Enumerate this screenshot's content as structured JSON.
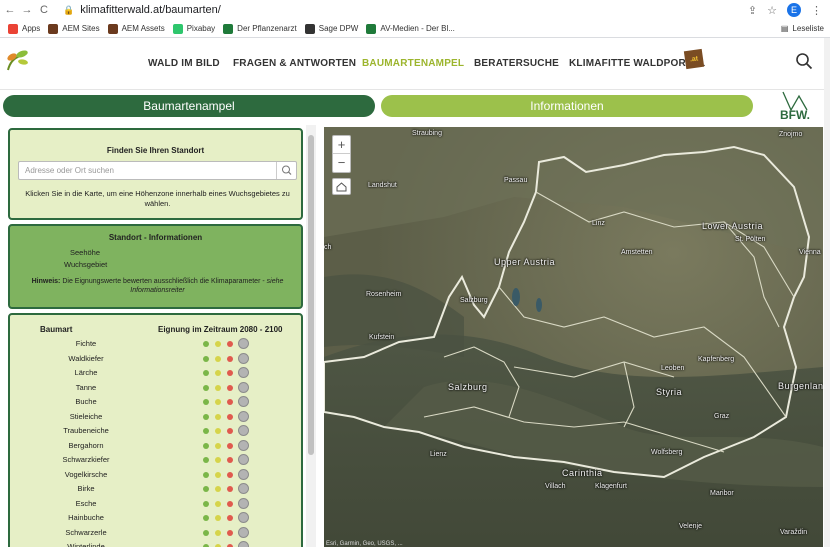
{
  "browser": {
    "url": "klimafitterwald.at/baumarten/",
    "profile_initial": "E",
    "bookmarks": [
      {
        "label": "Apps",
        "color": "#ea4335"
      },
      {
        "label": "AEM Sites",
        "color": "#6b3a1e"
      },
      {
        "label": "AEM Assets",
        "color": "#6b3a1e"
      },
      {
        "label": "Pixabay",
        "color": "#2ec66d"
      },
      {
        "label": "Der Pflanzenarzt",
        "color": "#1f7a3a"
      },
      {
        "label": "Sage DPW",
        "color": "#333333"
      },
      {
        "label": "AV-Medien - Der Bl...",
        "color": "#1f7a3a"
      }
    ],
    "reading_list": "Leseliste"
  },
  "site": {
    "nav": [
      {
        "label": "WALD IM BILD",
        "active": false
      },
      {
        "label": "FRAGEN & ANTWORTEN",
        "active": false
      },
      {
        "label": "BAUMARTENAMPEL",
        "active": true
      },
      {
        "label": "BERATERSUCHE",
        "active": false
      },
      {
        "label": "KLIMAFITTE WALDPORTAL",
        "active": false
      }
    ],
    "badge": ".at",
    "bfw_logo_text": "BFW."
  },
  "tabs": {
    "left": "Baumartenampel",
    "right": "Informationen"
  },
  "location_box": {
    "title": "Finden Sie Ihren Standort",
    "search_placeholder": "Adresse oder Ort suchen",
    "help_text": "Klicken Sie in die Karte, um eine Höhenzone innerhalb eines Wuchsgebietes zu wählen."
  },
  "info_box": {
    "title": "Standort - Informationen",
    "altitude_label": "Seehöhe",
    "region_label": "Wuchsgebiet",
    "hint_label": "Hinweis:",
    "hint_text": "Die Eignungswerte bewerten ausschließlich die Klimaparameter -",
    "hint_link": "siehe Informationsreiter"
  },
  "species_table": {
    "col_species": "Baumart",
    "col_suitability": "Eignung im Zeitraum 2080 - 2100",
    "species": [
      "Fichte",
      "Waldkiefer",
      "Lärche",
      "Tanne",
      "Buche",
      "Stieleiche",
      "Traubeneiche",
      "Bergahorn",
      "Schwarzkiefer",
      "Vogelkirsche",
      "Birke",
      "Esche",
      "Hainbuche",
      "Schwarzerle",
      "Winterlinde"
    ]
  },
  "map": {
    "zoom_in": "+",
    "zoom_out": "−",
    "attribution": "Esri, Garmin, Geo, USGS, ...",
    "labels": [
      {
        "text": "Straubing",
        "big": false
      },
      {
        "text": "Znojmo",
        "big": false
      },
      {
        "text": "Landshut",
        "big": false
      },
      {
        "text": "Passau",
        "big": false
      },
      {
        "text": "Lower Austria",
        "big": true
      },
      {
        "text": "Linz",
        "big": false
      },
      {
        "text": "St. Pölten",
        "big": false
      },
      {
        "text": "Amstetten",
        "big": false
      },
      {
        "text": "Vienna",
        "big": false
      },
      {
        "text": "Upper Austria",
        "big": true
      },
      {
        "text": "Rosenheim",
        "big": false
      },
      {
        "text": "Salzburg",
        "big": false
      },
      {
        "text": "Kufstein",
        "big": false
      },
      {
        "text": "Kapfenberg",
        "big": false
      },
      {
        "text": "Leoben",
        "big": false
      },
      {
        "text": "Burgenland",
        "big": true
      },
      {
        "text": "Salzburg",
        "big": true
      },
      {
        "text": "Styria",
        "big": true
      },
      {
        "text": "Graz",
        "big": false
      },
      {
        "text": "Lienz",
        "big": false
      },
      {
        "text": "Wolfsberg",
        "big": false
      },
      {
        "text": "Carinthia",
        "big": true
      },
      {
        "text": "Villach",
        "big": false
      },
      {
        "text": "Klagenfurt",
        "big": false
      },
      {
        "text": "Maribor",
        "big": false
      },
      {
        "text": "Velenje",
        "big": false
      },
      {
        "text": "Varaždin",
        "big": false
      },
      {
        "text": "ch",
        "big": false
      }
    ]
  }
}
